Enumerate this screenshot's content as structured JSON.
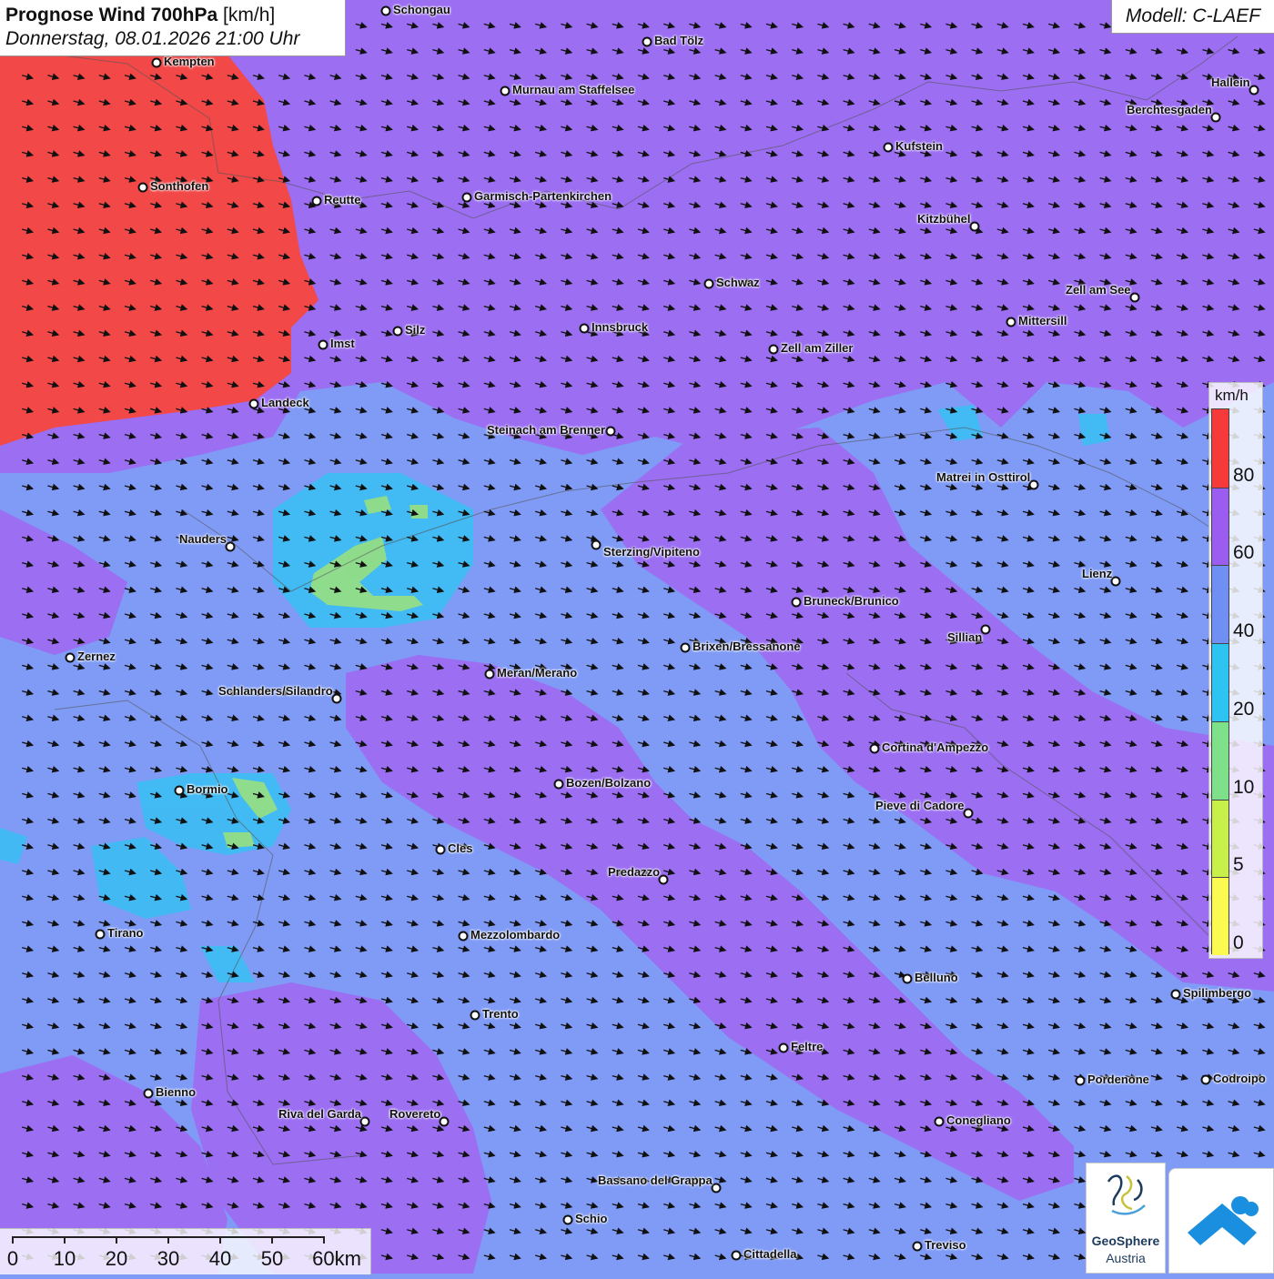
{
  "title": {
    "main": "Prognose Wind 700hPa",
    "unit": "[km/h]",
    "subtitle": "Donnerstag, 08.01.2026 21:00 Uhr"
  },
  "model_label": "Modell: C-LAEF",
  "legend": {
    "unit": "km/h",
    "ticks": [
      "80",
      "60",
      "40",
      "20",
      "10",
      "5",
      "0"
    ],
    "colors": [
      "#f63a3a",
      "#9b5cf0",
      "#6f8ff2",
      "#2ec4f2",
      "#7fe08a",
      "#c8f04a",
      "#fafa50"
    ]
  },
  "scale_bar": {
    "labels": [
      "0",
      "10",
      "20",
      "30",
      "40",
      "50",
      "60km"
    ]
  },
  "logo": {
    "name": "GeoSphere",
    "sub": "Austria"
  },
  "wind": {
    "arrow_direction_deg": 15,
    "dominant_speed_band_kmh": "40-60"
  },
  "cities": [
    {
      "name": "Schongau"
    },
    {
      "name": "Bad Tölz"
    },
    {
      "name": "Kempten"
    },
    {
      "name": "Murnau am Staffelsee"
    },
    {
      "name": "Hallein"
    },
    {
      "name": "Berchtesgaden"
    },
    {
      "name": "Kufstein"
    },
    {
      "name": "Sonthofen"
    },
    {
      "name": "Reutte"
    },
    {
      "name": "Garmisch-Partenkirchen"
    },
    {
      "name": "Kitzbühel"
    },
    {
      "name": "Schwaz"
    },
    {
      "name": "Zell am See"
    },
    {
      "name": "Mittersill"
    },
    {
      "name": "Innsbruck"
    },
    {
      "name": "Silz"
    },
    {
      "name": "Imst"
    },
    {
      "name": "Zell am Ziller"
    },
    {
      "name": "Landeck"
    },
    {
      "name": "Steinach am Brenner"
    },
    {
      "name": "Matrei in Osttirol"
    },
    {
      "name": "Nauders"
    },
    {
      "name": "Sterzing/Vipiteno"
    },
    {
      "name": "Lienz"
    },
    {
      "name": "Bruneck/Brunico"
    },
    {
      "name": "Sillian"
    },
    {
      "name": "Zernez"
    },
    {
      "name": "Brixen/Bressanone"
    },
    {
      "name": "Meran/Merano"
    },
    {
      "name": "Schlanders/Silandro"
    },
    {
      "name": "Cortina d'Ampezzo"
    },
    {
      "name": "Bozen/Bolzano"
    },
    {
      "name": "Bormio"
    },
    {
      "name": "Pieve di Cadore"
    },
    {
      "name": "Cles"
    },
    {
      "name": "Predazzo"
    },
    {
      "name": "Tirano"
    },
    {
      "name": "Mezzolombardo"
    },
    {
      "name": "Belluno"
    },
    {
      "name": "Spilimbergo"
    },
    {
      "name": "Trento"
    },
    {
      "name": "Feltre"
    },
    {
      "name": "Bienno"
    },
    {
      "name": "Pordenone"
    },
    {
      "name": "Codroipo"
    },
    {
      "name": "Riva del Garda"
    },
    {
      "name": "Rovereto"
    },
    {
      "name": "Conegliano"
    },
    {
      "name": "Bassano del Grappa"
    },
    {
      "name": "Schio"
    },
    {
      "name": "Treviso"
    },
    {
      "name": "Cittadella"
    }
  ]
}
